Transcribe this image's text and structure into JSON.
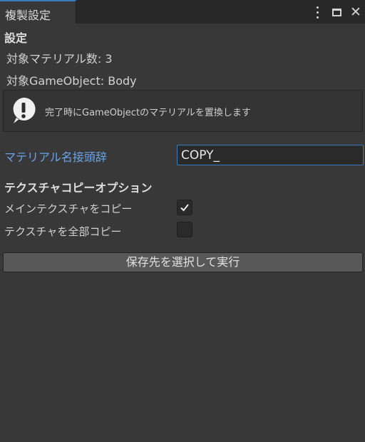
{
  "window": {
    "tab_title": "複製設定",
    "icons": [
      "kebab-menu-icon",
      "maximize-icon",
      "close-icon"
    ],
    "close_glyph": "✕"
  },
  "settings": {
    "header": "設定",
    "material_count_text": "対象マテリアル数: 3",
    "target_object_text": "対象GameObject: Body"
  },
  "help": {
    "icon": "exclamation-icon",
    "message": "完了時にGameObjectのマテリアルを置換します"
  },
  "prefix": {
    "label": "マテリアル名接頭辞",
    "value": "COPY_"
  },
  "texture_options": {
    "header": "テクスチャコピーオプション",
    "items": [
      {
        "label": "メインテクスチャをコピー",
        "checked": true
      },
      {
        "label": "テクスチャを全部コピー",
        "checked": false
      }
    ]
  },
  "action": {
    "button_label": "保存先を選択して実行"
  },
  "colors": {
    "background": "#383838",
    "titlebar": "#282828",
    "accent": "#3a79bb",
    "label_highlight": "#6aa3e8"
  }
}
